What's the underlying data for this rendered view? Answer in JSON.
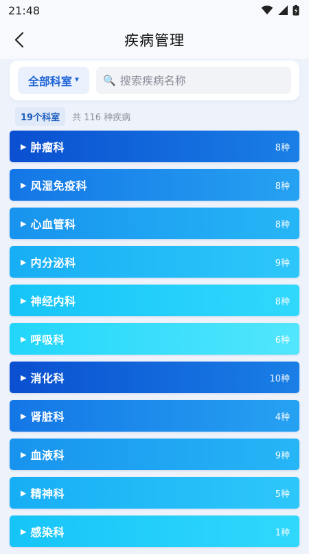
{
  "status": {
    "time": "21:48"
  },
  "header": {
    "title": "疾病管理"
  },
  "filter": {
    "dept_label": "全部科室",
    "search_placeholder": "搜索疾病名称"
  },
  "summary": {
    "badge": "19个科室",
    "text": "共 116 种疾病"
  },
  "departments": [
    {
      "name": "肿瘤科",
      "count": "8种",
      "style": "c1"
    },
    {
      "name": "风湿免疫科",
      "count": "8种",
      "style": "c2"
    },
    {
      "name": "心血管科",
      "count": "8种",
      "style": "c3"
    },
    {
      "name": "内分泌科",
      "count": "9种",
      "style": "c4"
    },
    {
      "name": "神经内科",
      "count": "8种",
      "style": "c5"
    },
    {
      "name": "呼吸科",
      "count": "6种",
      "style": "c6"
    },
    {
      "name": "消化科",
      "count": "10种",
      "style": "c1"
    },
    {
      "name": "肾脏科",
      "count": "4种",
      "style": "c2"
    },
    {
      "name": "血液科",
      "count": "9种",
      "style": "c3"
    },
    {
      "name": "精神科",
      "count": "5种",
      "style": "c4"
    },
    {
      "name": "感染科",
      "count": "1种",
      "style": "c5"
    }
  ],
  "icons": {
    "expand": "▶",
    "search": "🔍",
    "caret": "▼"
  }
}
